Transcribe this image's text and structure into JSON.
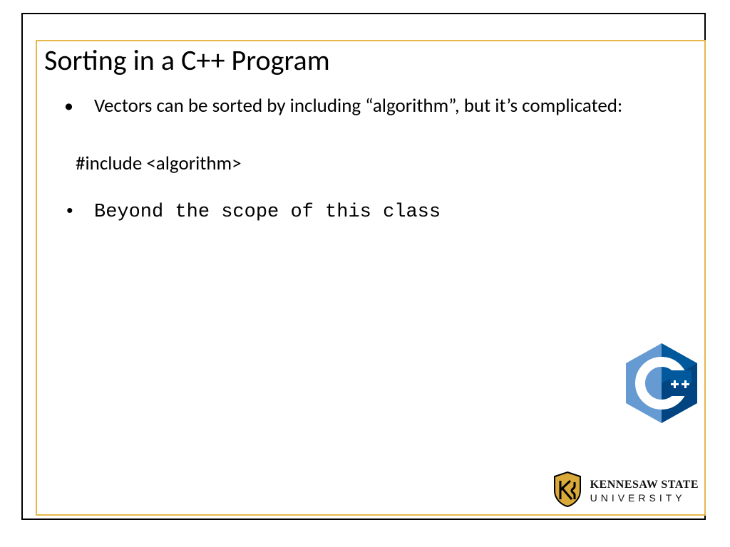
{
  "slide": {
    "title": "Sorting in a C++ Program",
    "bullets": [
      "Vectors can be sorted by including “algorithm”, but it’s complicated:"
    ],
    "code_line": "#include <algorithm>",
    "bullets2": [
      "Beyond the scope of this class"
    ]
  },
  "logos": {
    "cpp": {
      "name": "cpp-logo",
      "label": "C",
      "plus": "++"
    },
    "ksu": {
      "line1": "KENNESAW STATE",
      "line2": "UNIVERSITY"
    }
  },
  "colors": {
    "gold": "#e6b84a",
    "ksu_gold": "#d9a93a",
    "cpp_blue_dark": "#004482",
    "cpp_blue_mid": "#00599c",
    "cpp_blue_light": "#659ad2"
  }
}
